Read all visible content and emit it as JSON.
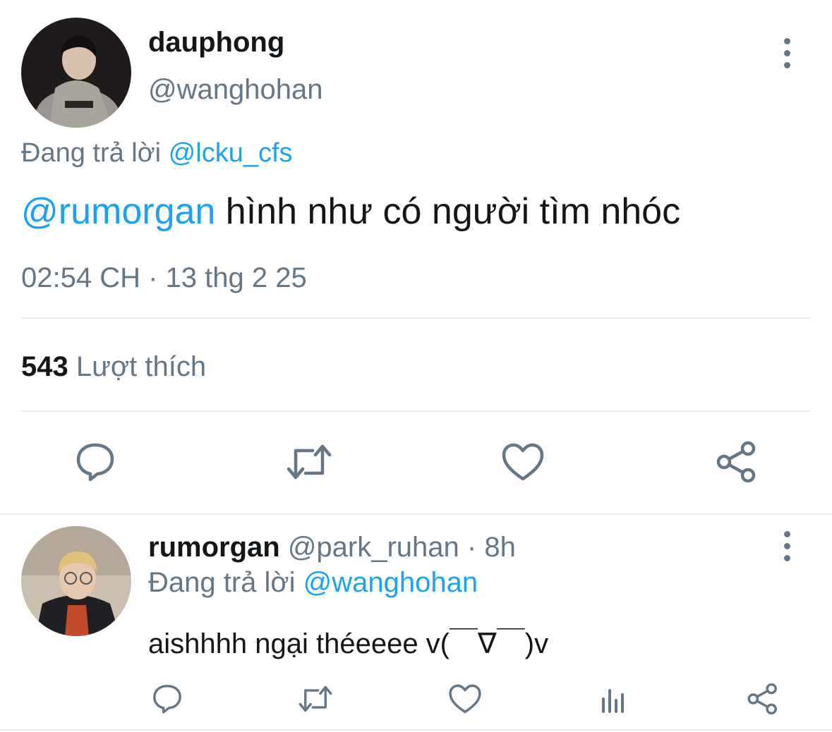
{
  "main_tweet": {
    "display_name": "dauphong",
    "handle": "@wanghohan",
    "reply_prefix": "Đang trả lời",
    "reply_to": "@lcku_cfs",
    "text_mention": "@rumorgan",
    "text_body": "hình như có người tìm nhóc",
    "timestamp": "02:54 CH · 13 thg 2 25",
    "likes_count": "543",
    "likes_label": "Lượt thích",
    "actions": [
      "reply-icon",
      "retweet-icon",
      "like-icon",
      "share-icon"
    ]
  },
  "reply_tweet": {
    "display_name": "rumorgan",
    "handle_time": "@park_ruhan · 8h",
    "reply_prefix": "Đang trả lời",
    "reply_to": "@wanghohan",
    "text": "aishhhh ngại théeeee v(￣∇￣)v",
    "actions": [
      "reply-icon",
      "retweet-icon",
      "like-icon",
      "analytics-icon",
      "share-icon"
    ]
  },
  "colors": {
    "accent": "#1da1f2",
    "secondary_text": "#657786",
    "primary_text": "#14171a",
    "divider": "#e6ecf0"
  }
}
